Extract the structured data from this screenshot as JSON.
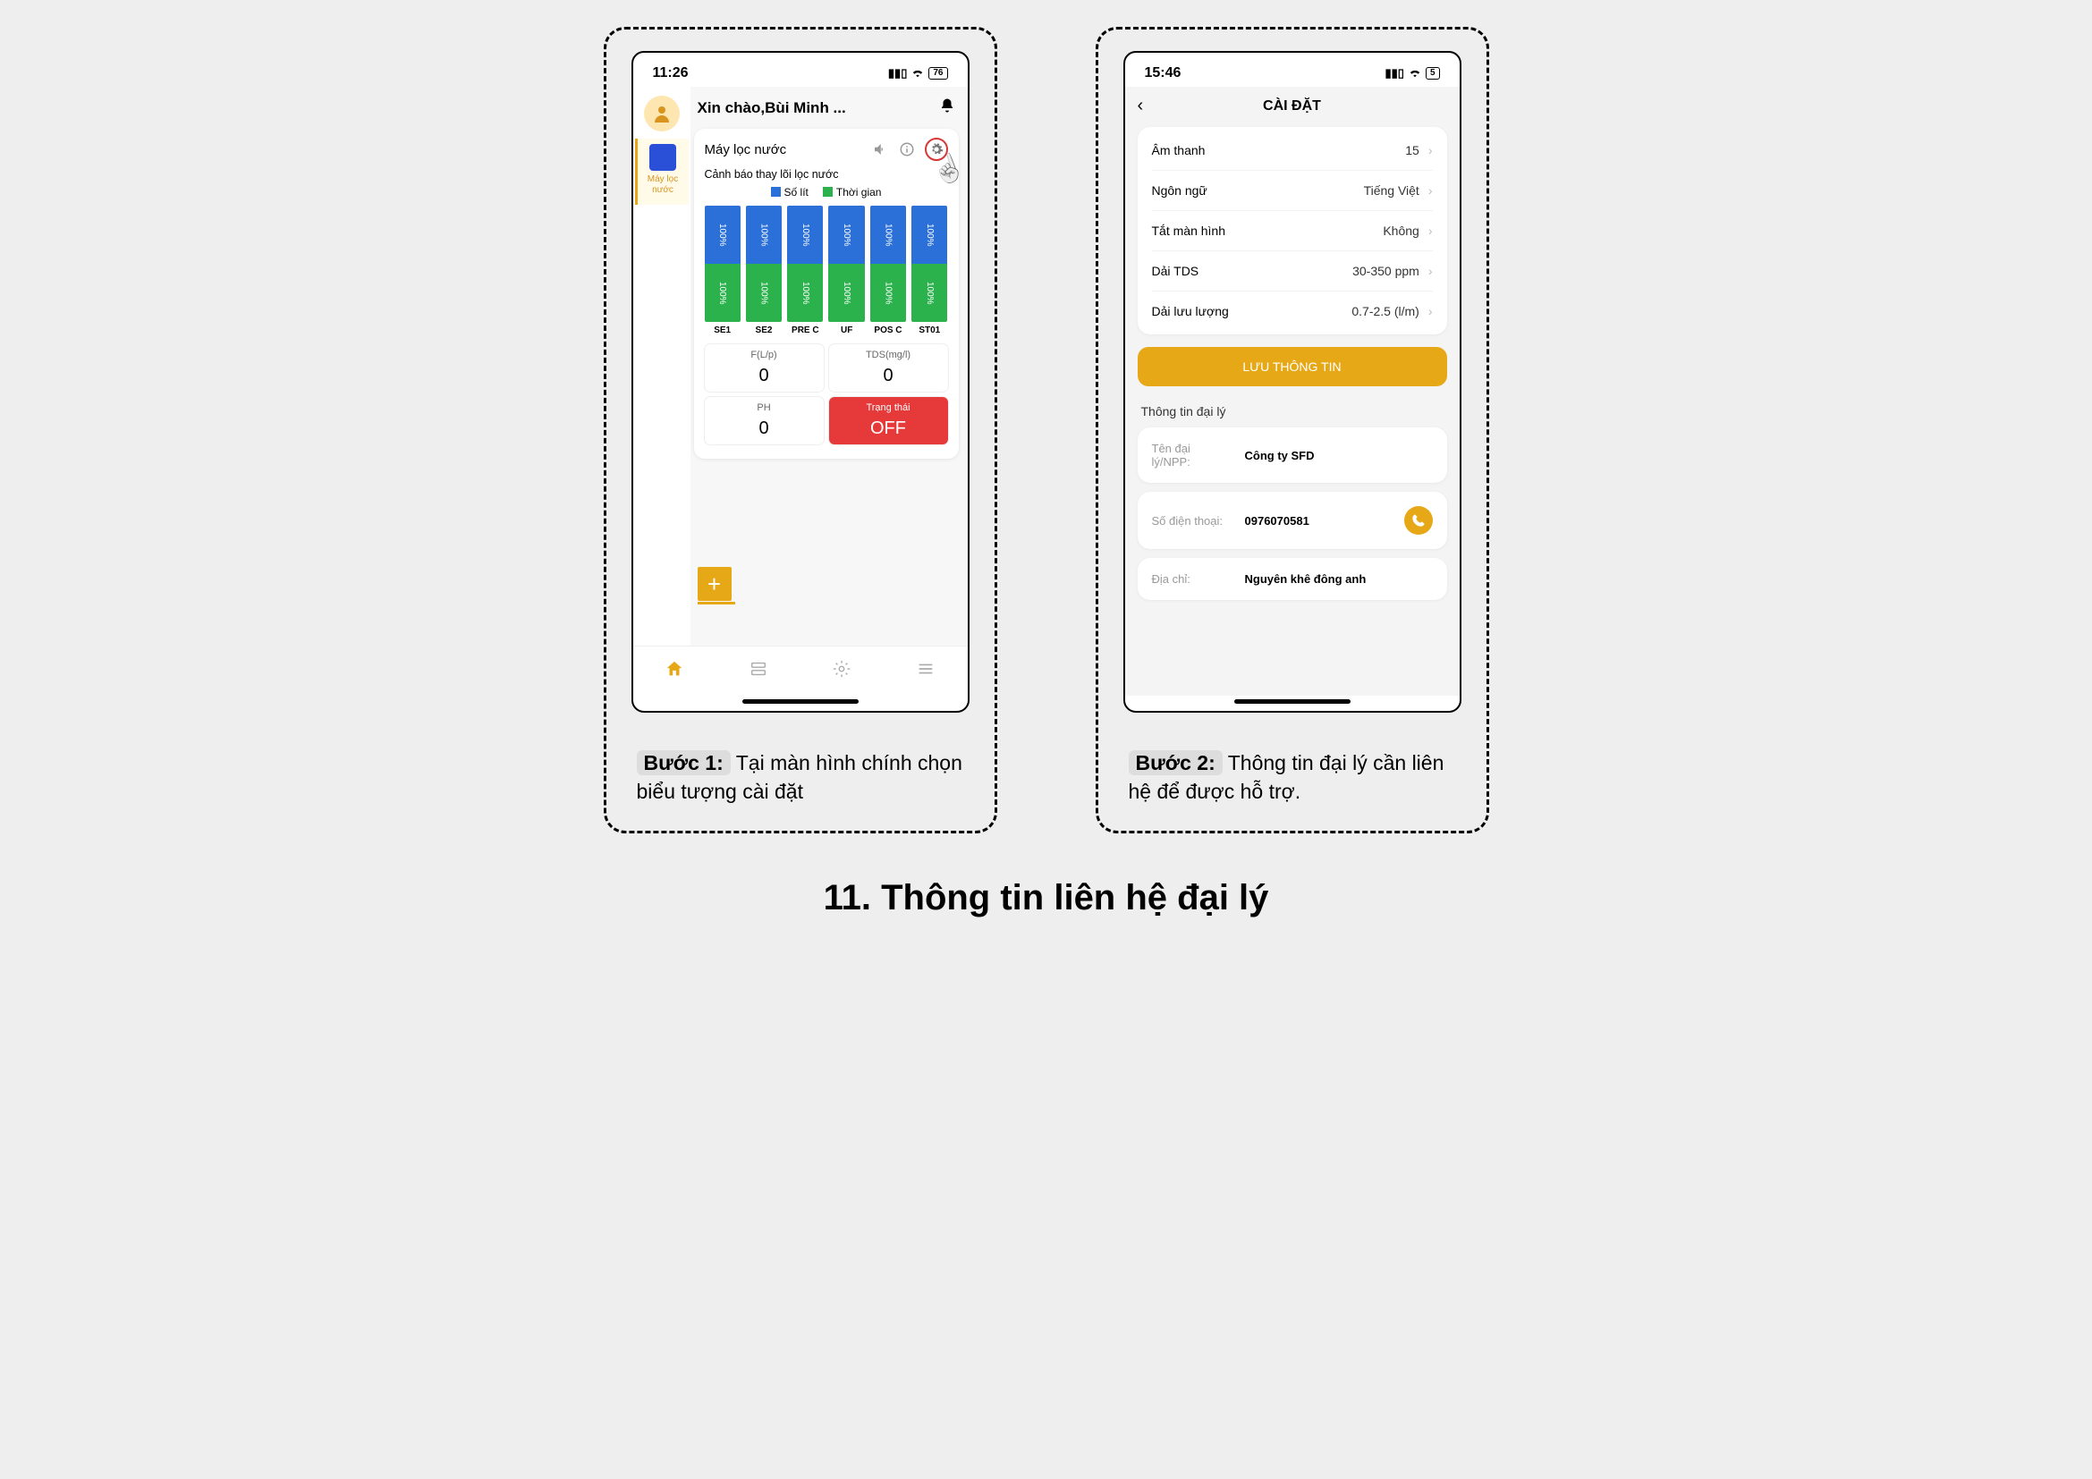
{
  "footer_title": "11. Thông tin liên hệ đại lý",
  "step1": {
    "caption_bold": "Bước 1:",
    "caption_text": " Tại màn hình chính chọn biểu tượng cài đặt",
    "status_time": "11:26",
    "status_battery": "76",
    "greeting": "Xin chào,Bùi Minh ...",
    "sidebar_device_label": "Máy lọc nước",
    "device_name": "Máy lọc nước",
    "warning_text": "Cảnh báo thay lõi lọc nước",
    "legend_liters": "Số lít",
    "legend_time": "Thời gian",
    "filters": [
      {
        "name": "SE1",
        "liters_pct": "100%",
        "time_pct": "100%"
      },
      {
        "name": "SE2",
        "liters_pct": "100%",
        "time_pct": "100%"
      },
      {
        "name": "PRE C",
        "liters_pct": "100%",
        "time_pct": "100%"
      },
      {
        "name": "UF",
        "liters_pct": "100%",
        "time_pct": "100%"
      },
      {
        "name": "POS C",
        "liters_pct": "100%",
        "time_pct": "100%"
      },
      {
        "name": "ST01",
        "liters_pct": "100%",
        "time_pct": "100%"
      }
    ],
    "stats": {
      "flp_label": "F(L/p)",
      "flp_value": "0",
      "tds_label": "TDS(mg/l)",
      "tds_value": "0",
      "ph_label": "PH",
      "ph_value": "0",
      "state_label": "Trạng thái",
      "state_value": "OFF"
    }
  },
  "step2": {
    "caption_bold": "Bước 2:",
    "caption_text": " Thông tin đại lý cần liên hệ để được hỗ trợ.",
    "status_time": "15:46",
    "status_battery": "5",
    "title": "CÀI ĐẶT",
    "rows": {
      "sound_k": "Âm thanh",
      "sound_v": "15",
      "lang_k": "Ngôn ngữ",
      "lang_v": "Tiếng Việt",
      "screen_k": "Tắt màn hình",
      "screen_v": "Không",
      "tds_k": "Dải TDS",
      "tds_v": "30-350 ppm",
      "flow_k": "Dải lưu lượng",
      "flow_v": "0.7-2.5 (l/m)"
    },
    "save_button": "LƯU THÔNG TIN",
    "dealer_section_title": "Thông tin đại lý",
    "dealer": {
      "name_k": "Tên đại lý/NPP:",
      "name_v": "Công ty SFD",
      "phone_k": "Số điện thoại:",
      "phone_v": "0976070581",
      "addr_k": "Địa chỉ:",
      "addr_v": "Nguyên khê đông anh"
    }
  }
}
